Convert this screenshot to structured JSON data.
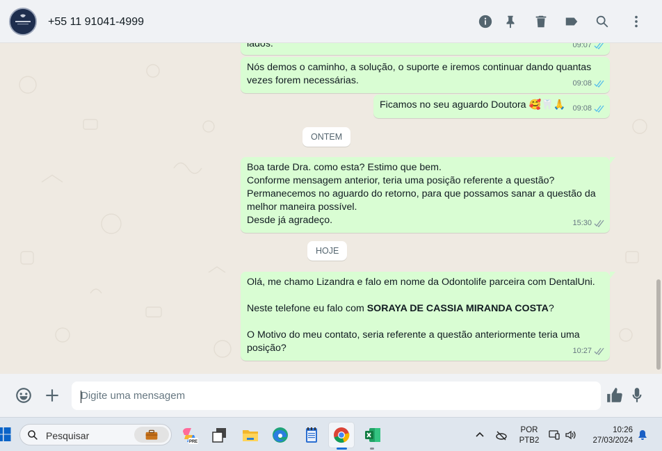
{
  "header": {
    "contact_name": "+55 11 91041-4999",
    "avatar_text": "SORAYA DE CASSIA"
  },
  "messages": [
    {
      "text": "lados.",
      "time": "09:07"
    },
    {
      "text": "Nós demos o caminho, a solução, o suporte e iremos continuar dando quantas\nvezes forem necessárias.",
      "time": "09:08"
    },
    {
      "text": "Ficamos no seu aguardo Doutora 🥰🦷🙏",
      "time": "09:08"
    },
    {
      "text": "Boa tarde Dra. como esta? Estimo que bem.\nConforme mensagem anterior, teria uma posição referente a questão?\nPermanecemos no aguardo do retorno, para que possamos sanar a questão da\nmelhor maneira possível.\nDesde já agradeço.",
      "time": "15:30"
    },
    {
      "line1": "Olá, me chamo Lizandra e falo em nome da Odontolife parceira com DentalUni.",
      "line2_prefix": "Neste telefone eu falo com ",
      "line2_bold": "SORAYA DE CASSIA MIRANDA COSTA",
      "line2_suffix": "?",
      "line3": "O Motivo do meu contato, seria referente a questão anteriormente teria uma\nposição?",
      "time": "10:27"
    }
  ],
  "day_chips": {
    "yesterday": "ONTEM",
    "today": "HOJE"
  },
  "composer": {
    "placeholder": "Digite uma mensagem"
  },
  "taskbar": {
    "search_label": "Pesquisar",
    "lang_line1": "POR",
    "lang_line2": "PTB2",
    "time": "10:26",
    "date": "27/03/2024",
    "copilot_badge": "PRE"
  },
  "colors": {
    "outgoing_bubble": "#d9fdd3",
    "read_ticks": "#53bdeb",
    "icons": "#54656f",
    "header_bg": "#f0f2f5",
    "chat_bg": "#efeae2"
  }
}
